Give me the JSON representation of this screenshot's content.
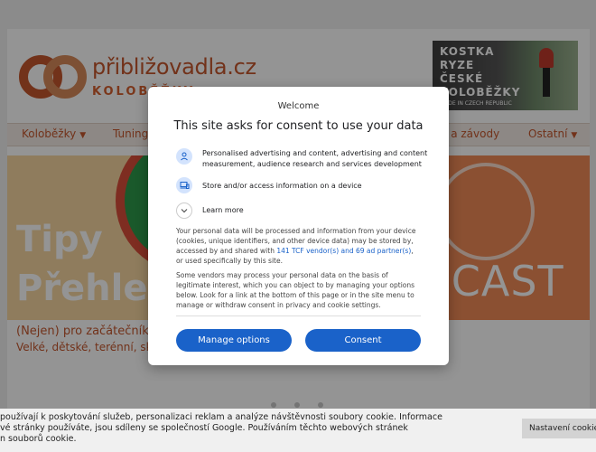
{
  "site": {
    "logo_title": "přibližovadla.cz",
    "logo_subtitle": "KOLOBĚŽKY",
    "ad": {
      "line1": "KOSTKA",
      "line2": "RYZE",
      "line3": "ČESKÉ",
      "line4": "KOLOBĚŽKY",
      "small": "MADE IN CZECH REPUBLIC"
    },
    "nav": [
      {
        "label": "Koloběžky"
      },
      {
        "label": "Tuning"
      },
      {
        "label": "e a závody"
      },
      {
        "label": "Ostatní"
      }
    ],
    "hero": {
      "word1": "Tipy",
      "word2": "Přehle",
      "podcast_word": "BCAST",
      "caption1": "(Nejen) pro začátečníky",
      "caption2": "Velké, dětské, terénní, sk"
    }
  },
  "dialog": {
    "eyebrow": "Welcome",
    "title": "This site asks for consent to use your data",
    "purposes": [
      {
        "icon": "person-icon",
        "text": "Personalised advertising and content, advertising and content measurement, audience research and services development"
      },
      {
        "icon": "devices-icon",
        "text": "Store and/or access information on a device"
      }
    ],
    "learn_more": "Learn more",
    "paragraph1_a": "Your personal data will be processed and information from your device (cookies, unique identifiers, and other device data) may be stored by, accessed by and shared with ",
    "paragraph1_link": "141 TCF vendor(s) and 69 ad partner(s)",
    "paragraph1_b": ", or used specifically by this site.",
    "paragraph2": "Some vendors may process your personal data on the basis of legitimate interest, which you can object to by managing your options below. Look for a link at the bottom of this page or in the site menu to manage or withdraw consent in privacy and cookie settings.",
    "manage_label": "Manage options",
    "consent_label": "Consent",
    "accent": "#1a62c9"
  },
  "cookie_bar": {
    "line1": "používají k poskytování služeb, personalizaci reklam a analýze návštěvnosti soubory cookie. Informace",
    "line2": "vé stránky používáte, jsou sdíleny se společností Google. Používáním těchto webových stránek",
    "line3": "n souborů cookie.",
    "settings_label": "Nastavení cookie"
  }
}
